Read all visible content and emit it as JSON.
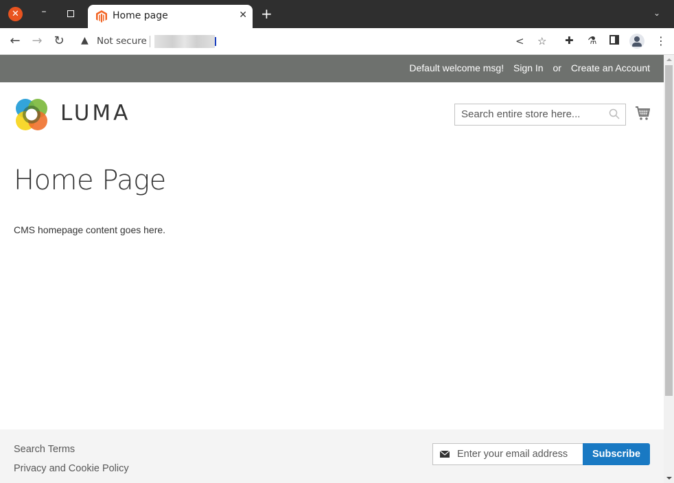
{
  "browser": {
    "tab_title": "Home page",
    "new_tab_symbol": "+",
    "address_warning": "Not secure",
    "icons": [
      "back-icon",
      "forward-icon",
      "reload-icon",
      "warning-icon",
      "share-icon",
      "star-icon",
      "extensions-icon",
      "labs-icon",
      "side-panel-icon",
      "profile-icon",
      "menu-icon"
    ]
  },
  "header": {
    "welcome": "Default welcome msg!",
    "sign_in": "Sign In",
    "or": "or",
    "create_account": "Create an Account",
    "logo_text": "LUMA",
    "search_placeholder": "Search entire store here..."
  },
  "main": {
    "title": "Home Page",
    "content": "CMS homepage content goes here."
  },
  "footer": {
    "links": [
      "Search Terms",
      "Privacy and Cookie Policy"
    ],
    "newsletter_placeholder": "Enter your email address",
    "subscribe_label": "Subscribe"
  },
  "colors": {
    "panel_header": "#6e716e",
    "subscribe": "#1979c3",
    "footer_bg": "#f4f4f4",
    "favicon": "#f26322"
  }
}
